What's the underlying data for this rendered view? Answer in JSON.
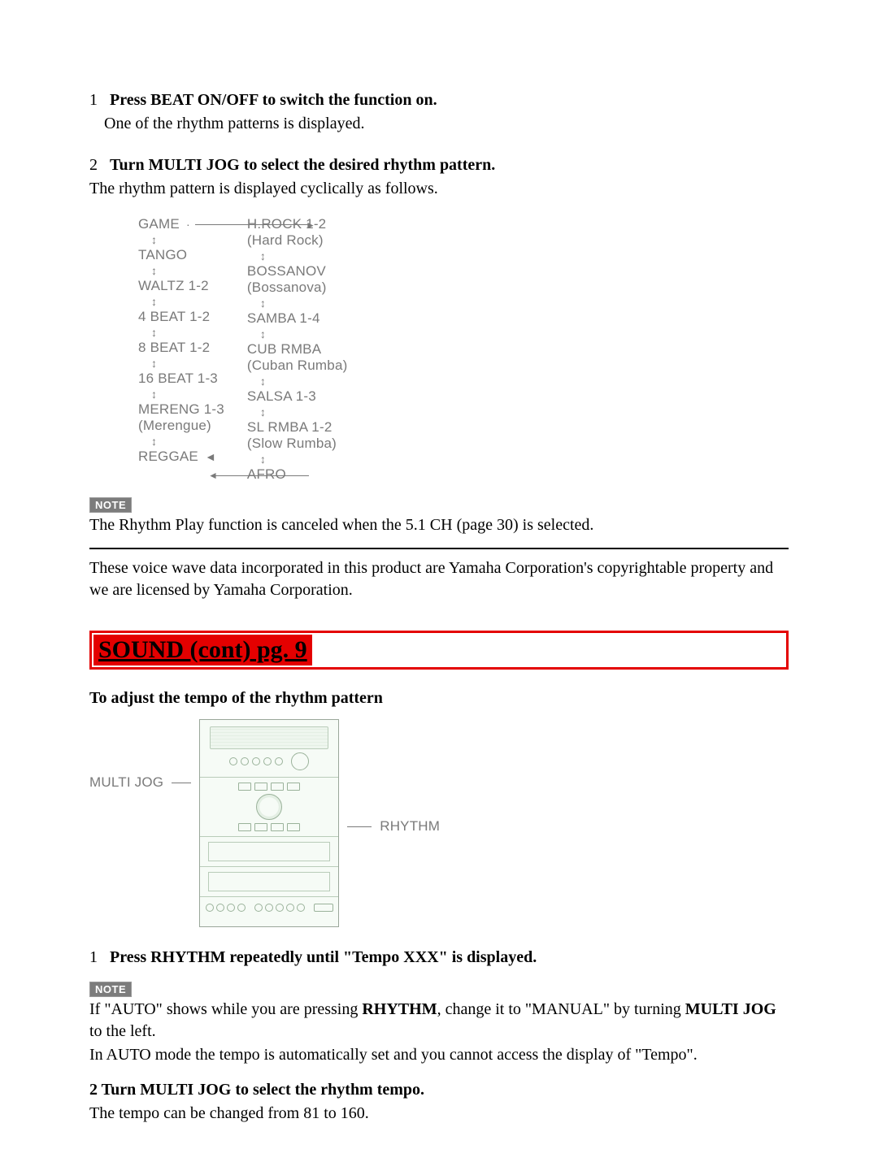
{
  "step1_number": "1",
  "step1_bold": "Press BEAT ON/OFF to switch the function on.",
  "step1_detail": "One of the rhythm patterns is displayed.",
  "step2_number": "2",
  "step2_bold": "Turn MULTI JOG to select the desired rhythm  pattern.",
  "step2_detail": "The rhythm pattern is displayed cyclically as follows.",
  "flow_left": [
    "GAME",
    "TANGO",
    "WALTZ 1-2",
    "4 BEAT 1-2",
    "8 BEAT 1-2",
    "16 BEAT 1-3",
    "MERENG 1-3",
    "(Merengue)",
    "REGGAE"
  ],
  "flow_right": [
    "H.ROCK 1-2",
    "(Hard Rock)",
    "BOSSANOV",
    "(Bossanova)",
    "SAMBA 1-4",
    "CUB RMBA",
    "(Cuban Rumba)",
    "SALSA 1-3",
    "SL RMBA 1-2",
    "(Slow Rumba)",
    "AFRO"
  ],
  "note_badge": "NOTE",
  "note1_text": "The Rhythm Play function is canceled when the 5.1 CH (page 30) is selected.",
  "license_text": "These voice wave data incorporated in this product are Yamaha Corporation's copyrightable property and we are licensed by Yamaha Corporation.",
  "section_header": "SOUND (cont)  pg. 9",
  "tempo_heading": "To adjust the tempo of the  rhythm pattern",
  "label_multi_jog": "MULTI JOG",
  "label_rhythm": "RHYTHM",
  "step3_number": "1",
  "step3_bold": "Press RHYTHM repeatedly until \"Tempo XXX\" is displayed.",
  "note2_part1": "If \"AUTO\" shows while you are pressing ",
  "note2_bold1": "RHYTHM",
  "note2_part2": ", change it to \"MANUAL\" by turning ",
  "note2_bold2": "MULTI JOG",
  "note2_part3": " to the left.",
  "note2_line2": "In AUTO mode the tempo is automatically set and you cannot access the display of \"Tempo\".",
  "step4_line": "2 Turn MULTI JOG to select the rhythm tempo.",
  "step4_detail": "The tempo can be changed from 81 to 160."
}
